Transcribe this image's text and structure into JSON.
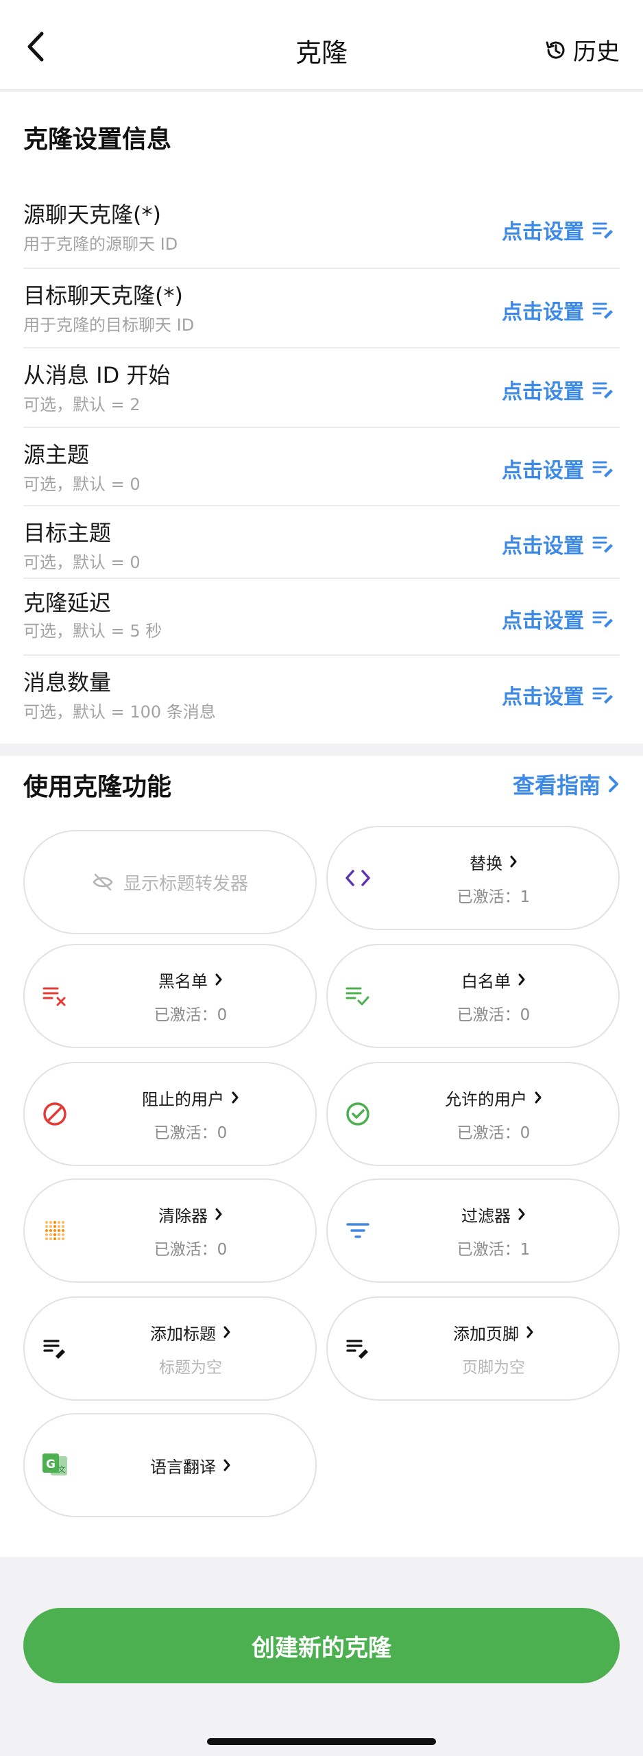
{
  "header": {
    "title": "克隆",
    "history_label": "历史"
  },
  "settings": {
    "section_title": "克隆设置信息",
    "action_label": "点击设置",
    "rows": [
      {
        "label": "源聊天克隆(*)",
        "hint": "用于克隆的源聊天 ID"
      },
      {
        "label": "目标聊天克隆(*)",
        "hint": "用于克隆的目标聊天 ID"
      },
      {
        "label": "从消息 ID 开始",
        "hint": "可选，默认 = 2"
      },
      {
        "label": "源主题",
        "hint": "可选，默认 = 0"
      },
      {
        "label": "目标主题",
        "hint": "可选，默认 = 0"
      },
      {
        "label": "克隆延迟",
        "hint": "可选，默认 = 5 秒"
      },
      {
        "label": "消息数量",
        "hint": "可选，默认 = 100 条消息"
      }
    ]
  },
  "features": {
    "section_title": "使用克隆功能",
    "guide_label": "查看指南",
    "show_header_forwarder": "显示标题转发器",
    "items": [
      {
        "title": "替换",
        "sub": "已激活：1",
        "icon": "code-icon"
      },
      {
        "title": "黑名单",
        "sub": "已激活：0",
        "icon": "blacklist-icon"
      },
      {
        "title": "白名单",
        "sub": "已激活：0",
        "icon": "whitelist-icon"
      },
      {
        "title": "阻止的用户",
        "sub": "已激活：0",
        "icon": "block-icon"
      },
      {
        "title": "允许的用户",
        "sub": "已激活：0",
        "icon": "check-circle-icon"
      },
      {
        "title": "清除器",
        "sub": "已激活：0",
        "icon": "dots-grid-icon"
      },
      {
        "title": "过滤器",
        "sub": "已激活：1",
        "icon": "filter-icon"
      },
      {
        "title": "添加标题",
        "sub": "标题为空",
        "icon": "edit-list-icon"
      },
      {
        "title": "添加页脚",
        "sub": "页脚为空",
        "icon": "edit-list-icon"
      },
      {
        "title": "语言翻译",
        "sub": "",
        "icon": "translate-icon"
      }
    ]
  },
  "footer": {
    "create_label": "创建新的克隆"
  },
  "colors": {
    "accent_blue": "#3d8ae6",
    "green": "#4caf50",
    "red": "#e53935",
    "purple": "#5e35b1",
    "orange": "#fb8c00"
  }
}
